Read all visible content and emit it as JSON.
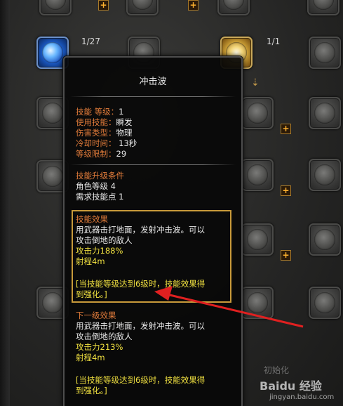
{
  "skill_tree": {
    "slots": [
      {
        "name": "top-left-slot",
        "style": "plain"
      },
      {
        "name": "top-mid-slot",
        "style": "plain"
      },
      {
        "name": "top-right-slot",
        "style": "plain"
      }
    ],
    "active_skill_level": "1/27",
    "linked_skill_level": "1/1",
    "plus_symbol": "+",
    "arrow_symbol": "⇣",
    "reset_button_label": "初始化"
  },
  "tooltip": {
    "title": "冲击波",
    "stats": [
      {
        "label": "技能 等级",
        "sep": "：",
        "value": "1"
      },
      {
        "label": "使用技能",
        "sep": "：",
        "value": "瞬发"
      },
      {
        "label": "伤害类型",
        "sep": "：",
        "value": "物理"
      },
      {
        "label": "冷却时间",
        "sep": "：",
        "value": " 13秒"
      },
      {
        "label": "等级限制",
        "sep": "：",
        "value": "29"
      }
    ],
    "upgrade": {
      "heading": "技能升级条件",
      "lines": [
        "角色等级 4",
        "需求技能点 1"
      ]
    },
    "effect": {
      "heading": "技能效果",
      "desc_line1": "用武器击打地面，发射冲击波。可以",
      "desc_line2": "攻击倒地的敌人",
      "attack": "攻击力188%",
      "range": "射程4m",
      "note_line1": "[当技能等级达到6级时，技能效果得",
      "note_line2": "到强化。]"
    },
    "next": {
      "heading": "下一级效果",
      "desc_line1": "用武器击打地面，发射冲击波。可以",
      "desc_line2": "攻击倒地的敌人",
      "attack": "攻击力213%",
      "range": "射程4m",
      "note_line1": "[当技能等级达到6级时，技能效果得",
      "note_line2": "到强化。]"
    }
  },
  "watermark": {
    "brand": "Baidu 经验",
    "url": "jingyan.baidu.com"
  },
  "colors": {
    "label_orange": "#e07b3a",
    "text_white": "#e8e8e8",
    "highlight_yellow": "#f0e040",
    "frame_gold": "#c89a3a",
    "pointer_red": "#e02020"
  }
}
